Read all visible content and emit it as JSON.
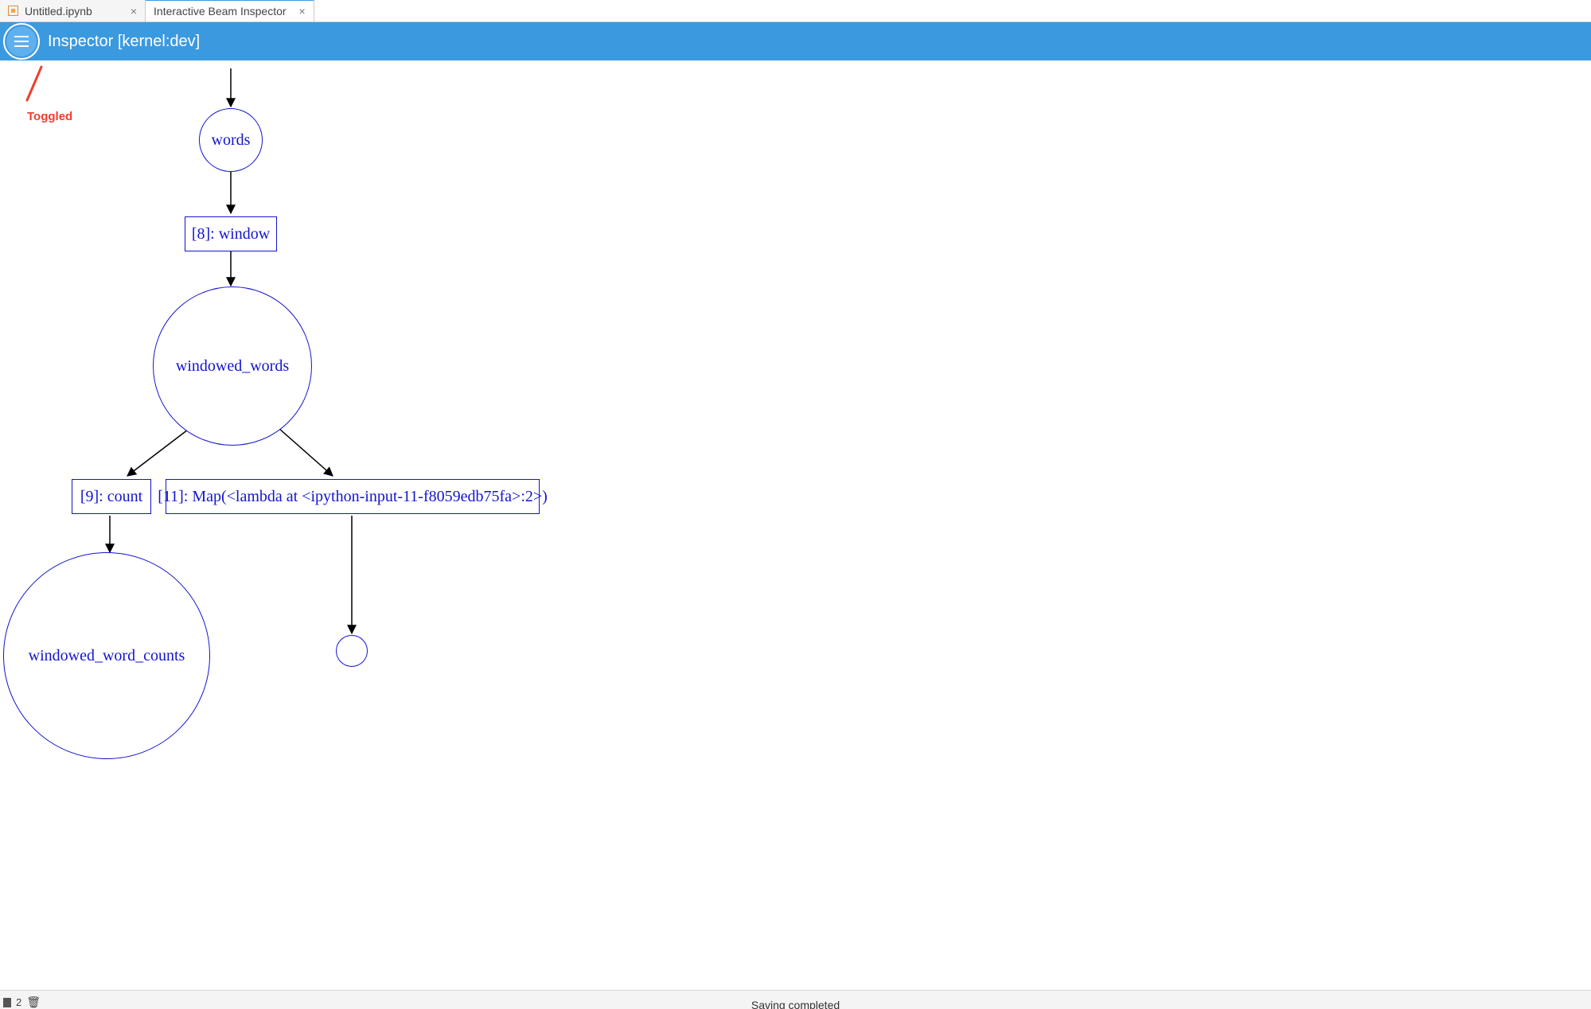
{
  "tabs": [
    {
      "label": "Untitled.ipynb",
      "has_icon": true,
      "closable": true,
      "active": false
    },
    {
      "label": "Interactive Beam Inspector",
      "has_icon": false,
      "closable": true,
      "active": true
    }
  ],
  "inspector": {
    "title": "Inspector [kernel:dev]",
    "menu_toggled": true
  },
  "annotation": {
    "label": "Toggled",
    "color": "#ef3e2f"
  },
  "graph": {
    "nodes": {
      "words": {
        "type": "circle",
        "label": "words"
      },
      "window": {
        "type": "box",
        "label": "[8]: window"
      },
      "windowed_words": {
        "type": "circle",
        "label": "windowed_words"
      },
      "count": {
        "type": "box",
        "label": "[9]: count"
      },
      "map": {
        "type": "box",
        "label": "[11]: Map(<lambda at <ipython-input-11-f8059edb75fa>:2>)"
      },
      "windowed_word_counts": {
        "type": "circle",
        "label": "windowed_word_counts"
      },
      "anon_out": {
        "type": "circle",
        "label": ""
      }
    },
    "edges": [
      {
        "from": "ENTRY",
        "to": "words"
      },
      {
        "from": "words",
        "to": "window"
      },
      {
        "from": "window",
        "to": "windowed_words"
      },
      {
        "from": "windowed_words",
        "to": "count"
      },
      {
        "from": "windowed_words",
        "to": "map"
      },
      {
        "from": "count",
        "to": "windowed_word_counts"
      },
      {
        "from": "map",
        "to": "anon_out"
      }
    ]
  },
  "statusbar": {
    "tab_count": "2",
    "message": "Saving completed"
  }
}
